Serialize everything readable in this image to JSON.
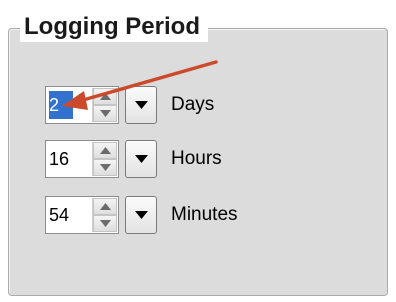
{
  "group": {
    "title": "Logging Period"
  },
  "fields": [
    {
      "value": "2",
      "unit": "Days",
      "selected": true
    },
    {
      "value": "16",
      "unit": "Hours",
      "selected": false
    },
    {
      "value": "54",
      "unit": "Minutes",
      "selected": false
    }
  ],
  "icons": {
    "spin_up": "triangle-up-icon",
    "spin_down": "triangle-down-icon",
    "dropdown": "chevron-down-icon",
    "annotation": "red-arrow-icon"
  },
  "colors": {
    "panel_bg": "#dcdcdc",
    "selection": "#3272ce",
    "annotation_arrow": "#cc4a2c"
  }
}
